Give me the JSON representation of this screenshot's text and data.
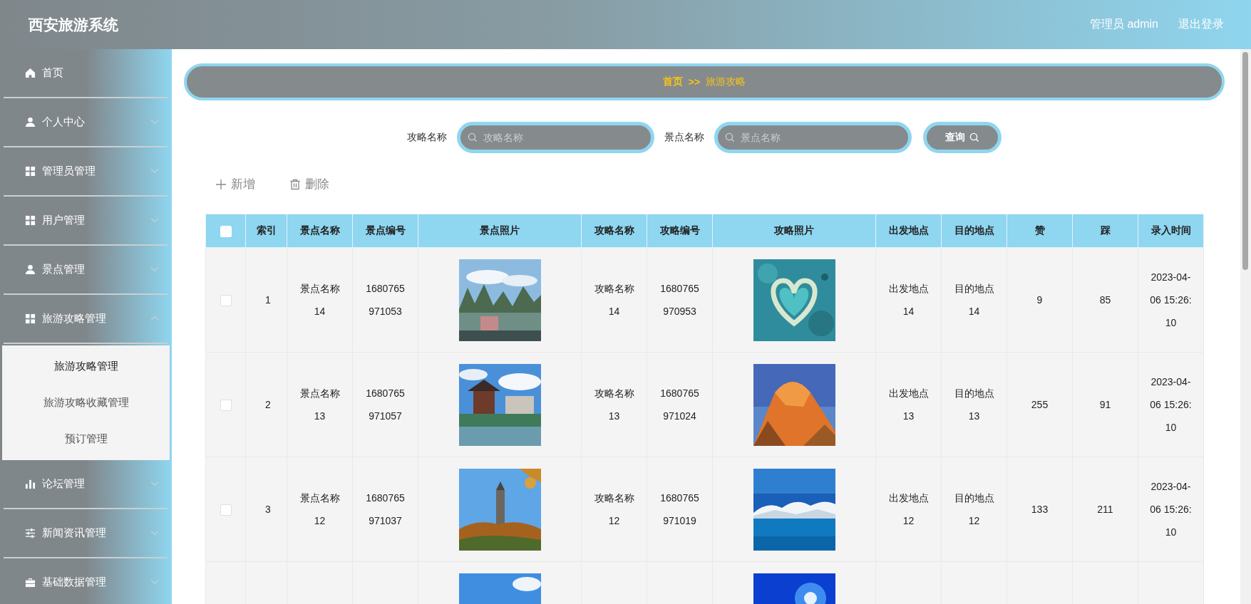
{
  "header": {
    "title": "西安旅游系统",
    "user": "管理员 admin",
    "logout": "退出登录"
  },
  "sidebar": {
    "items": [
      {
        "label": "首页",
        "kind": "link"
      },
      {
        "label": "个人中心",
        "kind": "menu",
        "expanded": false
      },
      {
        "label": "管理员管理",
        "kind": "menu",
        "expanded": false
      },
      {
        "label": "用户管理",
        "kind": "menu",
        "expanded": false
      },
      {
        "label": "景点管理",
        "kind": "menu",
        "expanded": false
      },
      {
        "label": "旅游攻略管理",
        "kind": "menu",
        "expanded": true,
        "children": [
          {
            "label": "旅游攻略管理",
            "selected": true
          },
          {
            "label": "旅游攻略收藏管理",
            "selected": false
          },
          {
            "label": "预订管理",
            "selected": false
          }
        ]
      },
      {
        "label": "论坛管理",
        "kind": "menu",
        "expanded": false
      },
      {
        "label": "新闻资讯管理",
        "kind": "menu",
        "expanded": false
      },
      {
        "label": "基础数据管理",
        "kind": "menu",
        "expanded": false
      }
    ]
  },
  "breadcrumb": {
    "home": "首页",
    "separator": ">>",
    "current": "旅游攻略"
  },
  "search": {
    "fields": [
      {
        "label": "攻略名称",
        "placeholder": "攻略名称"
      },
      {
        "label": "景点名称",
        "placeholder": "景点名称"
      }
    ],
    "button": "查询"
  },
  "toolbar": {
    "add": "新增",
    "delete": "删除"
  },
  "table": {
    "select_all": {
      "checked": false
    },
    "columns": [
      "索引",
      "景点名称",
      "景点编号",
      "景点照片",
      "攻略名称",
      "攻略编号",
      "攻略照片",
      "出发地点",
      "目的地点",
      "赞",
      "踩",
      "录入时间"
    ],
    "rows": [
      {
        "checked": false,
        "index": "1",
        "scenic_name": "景点名称14",
        "scenic_no": "1680765971053",
        "scenic_photo": {
          "kind": "picture"
        },
        "guide_name": "攻略名称14",
        "guide_no": "1680765970953",
        "guide_photo": {
          "kind": "picture"
        },
        "departure": "出发地点14",
        "destination": "目的地点14",
        "likes": "9",
        "dislikes": "85",
        "created": "2023-04-06 15:26:10"
      },
      {
        "checked": false,
        "index": "2",
        "scenic_name": "景点名称13",
        "scenic_no": "1680765971057",
        "scenic_photo": {
          "kind": "picture"
        },
        "guide_name": "攻略名称13",
        "guide_no": "1680765971024",
        "guide_photo": {
          "kind": "picture"
        },
        "departure": "出发地点13",
        "destination": "目的地点13",
        "likes": "255",
        "dislikes": "91",
        "created": "2023-04-06 15:26:10"
      },
      {
        "checked": false,
        "index": "3",
        "scenic_name": "景点名称12",
        "scenic_no": "1680765971037",
        "scenic_photo": {
          "kind": "picture"
        },
        "guide_name": "攻略名称12",
        "guide_no": "1680765971019",
        "guide_photo": {
          "kind": "picture"
        },
        "departure": "出发地点12",
        "destination": "目的地点12",
        "likes": "133",
        "dislikes": "211",
        "created": "2023-04-06 15:26:10"
      },
      {
        "scenic_photo": {
          "kind": "picture"
        },
        "guide_photo": {
          "kind": "picture"
        }
      }
    ]
  }
}
